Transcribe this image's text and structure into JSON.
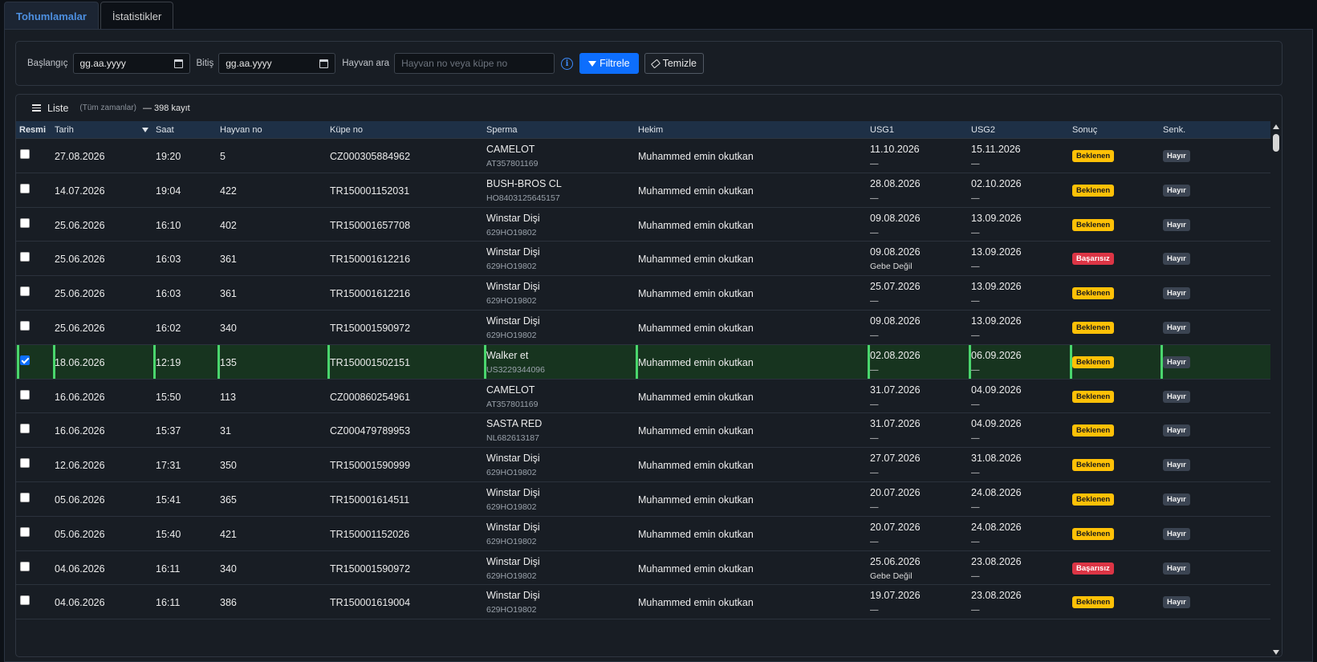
{
  "tabs": [
    {
      "label": "Tohumlamalar",
      "active": true
    },
    {
      "label": "İstatistikler",
      "active": false
    }
  ],
  "filters": {
    "start_label": "Başlangıç",
    "start_value": "gg.aa.yyyy",
    "end_label": "Bitiş",
    "end_value": "gg.aa.yyyy",
    "animal_label": "Hayvan ara",
    "animal_placeholder": "Hayvan no veya küpe no",
    "filter_button": "Filtrele",
    "clear_button": "Temizle",
    "info_glyph": "i"
  },
  "list": {
    "title": "Liste",
    "subtitle": "(Tüm zamanlar)",
    "count": "— 398 kayıt"
  },
  "columns": [
    "Resmi",
    "Tarih",
    "Saat",
    "Hayvan no",
    "Küpe no",
    "Sperma",
    "Hekim",
    "USG1",
    "USG2",
    "Sonuç",
    "Senk."
  ],
  "rows": [
    {
      "checked": false,
      "date": "27.08.2026",
      "time": "19:20",
      "animal": "5",
      "tag": "CZ000305884962",
      "sperm": "CAMELOT",
      "sperm_code": "AT357801169",
      "vet": "Muhammed emin okutkan",
      "usg1": "11.10.2026",
      "usg1_note": "—",
      "usg2": "15.11.2026",
      "usg2_note": "—",
      "result": "Beklenen",
      "result_type": "warn",
      "sync": "Hayır"
    },
    {
      "checked": false,
      "date": "14.07.2026",
      "time": "19:04",
      "animal": "422",
      "tag": "TR150001152031",
      "sperm": "BUSH-BROS CL",
      "sperm_code": "HO8403125645157",
      "vet": "Muhammed emin okutkan",
      "usg1": "28.08.2026",
      "usg1_note": "—",
      "usg2": "02.10.2026",
      "usg2_note": "—",
      "result": "Beklenen",
      "result_type": "warn",
      "sync": "Hayır"
    },
    {
      "checked": false,
      "date": "25.06.2026",
      "time": "16:10",
      "animal": "402",
      "tag": "TR150001657708",
      "sperm": "Winstar Dişi",
      "sperm_code": "629HO19802",
      "vet": "Muhammed emin okutkan",
      "usg1": "09.08.2026",
      "usg1_note": "—",
      "usg2": "13.09.2026",
      "usg2_note": "—",
      "result": "Beklenen",
      "result_type": "warn",
      "sync": "Hayır"
    },
    {
      "checked": false,
      "date": "25.06.2026",
      "time": "16:03",
      "animal": "361",
      "tag": "TR150001612216",
      "sperm": "Winstar Dişi",
      "sperm_code": "629HO19802",
      "vet": "Muhammed emin okutkan",
      "usg1": "09.08.2026",
      "usg1_note": "Gebe Değil",
      "usg2": "13.09.2026",
      "usg2_note": "—",
      "result": "Başarısız",
      "result_type": "fail",
      "sync": "Hayır"
    },
    {
      "checked": false,
      "date": "25.06.2026",
      "time": "16:03",
      "animal": "361",
      "tag": "TR150001612216",
      "sperm": "Winstar Dişi",
      "sperm_code": "629HO19802",
      "vet": "Muhammed emin okutkan",
      "usg1": "25.07.2026",
      "usg1_note": "—",
      "usg2": "13.09.2026",
      "usg2_note": "—",
      "result": "Beklenen",
      "result_type": "warn",
      "sync": "Hayır"
    },
    {
      "checked": false,
      "date": "25.06.2026",
      "time": "16:02",
      "animal": "340",
      "tag": "TR150001590972",
      "sperm": "Winstar Dişi",
      "sperm_code": "629HO19802",
      "vet": "Muhammed emin okutkan",
      "usg1": "09.08.2026",
      "usg1_note": "—",
      "usg2": "13.09.2026",
      "usg2_note": "—",
      "result": "Beklenen",
      "result_type": "warn",
      "sync": "Hayır"
    },
    {
      "checked": true,
      "date": "18.06.2026",
      "time": "12:19",
      "animal": "135",
      "tag": "TR150001502151",
      "sperm": "Walker et",
      "sperm_code": "US3229344096",
      "vet": "Muhammed emin okutkan",
      "usg1": "02.08.2026",
      "usg1_note": "—",
      "usg2": "06.09.2026",
      "usg2_note": "—",
      "result": "Beklenen",
      "result_type": "warn",
      "sync": "Hayır"
    },
    {
      "checked": false,
      "date": "16.06.2026",
      "time": "15:50",
      "animal": "113",
      "tag": "CZ000860254961",
      "sperm": "CAMELOT",
      "sperm_code": "AT357801169",
      "vet": "Muhammed emin okutkan",
      "usg1": "31.07.2026",
      "usg1_note": "—",
      "usg2": "04.09.2026",
      "usg2_note": "—",
      "result": "Beklenen",
      "result_type": "warn",
      "sync": "Hayır"
    },
    {
      "checked": false,
      "date": "16.06.2026",
      "time": "15:37",
      "animal": "31",
      "tag": "CZ000479789953",
      "sperm": "SASTA RED",
      "sperm_code": "NL682613187",
      "vet": "Muhammed emin okutkan",
      "usg1": "31.07.2026",
      "usg1_note": "—",
      "usg2": "04.09.2026",
      "usg2_note": "—",
      "result": "Beklenen",
      "result_type": "warn",
      "sync": "Hayır"
    },
    {
      "checked": false,
      "date": "12.06.2026",
      "time": "17:31",
      "animal": "350",
      "tag": "TR150001590999",
      "sperm": "Winstar Dişi",
      "sperm_code": "629HO19802",
      "vet": "Muhammed emin okutkan",
      "usg1": "27.07.2026",
      "usg1_note": "—",
      "usg2": "31.08.2026",
      "usg2_note": "—",
      "result": "Beklenen",
      "result_type": "warn",
      "sync": "Hayır"
    },
    {
      "checked": false,
      "date": "05.06.2026",
      "time": "15:41",
      "animal": "365",
      "tag": "TR150001614511",
      "sperm": "Winstar Dişi",
      "sperm_code": "629HO19802",
      "vet": "Muhammed emin okutkan",
      "usg1": "20.07.2026",
      "usg1_note": "—",
      "usg2": "24.08.2026",
      "usg2_note": "—",
      "result": "Beklenen",
      "result_type": "warn",
      "sync": "Hayır"
    },
    {
      "checked": false,
      "date": "05.06.2026",
      "time": "15:40",
      "animal": "421",
      "tag": "TR150001152026",
      "sperm": "Winstar Dişi",
      "sperm_code": "629HO19802",
      "vet": "Muhammed emin okutkan",
      "usg1": "20.07.2026",
      "usg1_note": "—",
      "usg2": "24.08.2026",
      "usg2_note": "—",
      "result": "Beklenen",
      "result_type": "warn",
      "sync": "Hayır"
    },
    {
      "checked": false,
      "date": "04.06.2026",
      "time": "16:11",
      "animal": "340",
      "tag": "TR150001590972",
      "sperm": "Winstar Dişi",
      "sperm_code": "629HO19802",
      "vet": "Muhammed emin okutkan",
      "usg1": "25.06.2026",
      "usg1_note": "Gebe Değil",
      "usg2": "23.08.2026",
      "usg2_note": "—",
      "result": "Başarısız",
      "result_type": "fail",
      "sync": "Hayır"
    },
    {
      "checked": false,
      "date": "04.06.2026",
      "time": "16:11",
      "animal": "386",
      "tag": "TR150001619004",
      "sperm": "Winstar Dişi",
      "sperm_code": "629HO19802",
      "vet": "Muhammed emin okutkan",
      "usg1": "19.07.2026",
      "usg1_note": "—",
      "usg2": "23.08.2026",
      "usg2_note": "—",
      "result": "Beklenen",
      "result_type": "warn",
      "sync": "Hayır"
    }
  ],
  "icons": {
    "calendar": "calendar-icon",
    "info": "info-icon",
    "filter": "funnel-icon",
    "clear": "eraser-icon",
    "list": "list-icon",
    "sort": "sort-down-icon"
  },
  "colors": {
    "accent": "#0d6efd",
    "warn": "#ffc107",
    "fail": "#dc3545",
    "selected_row": "#17341f",
    "selected_border": "#4ad66d"
  }
}
